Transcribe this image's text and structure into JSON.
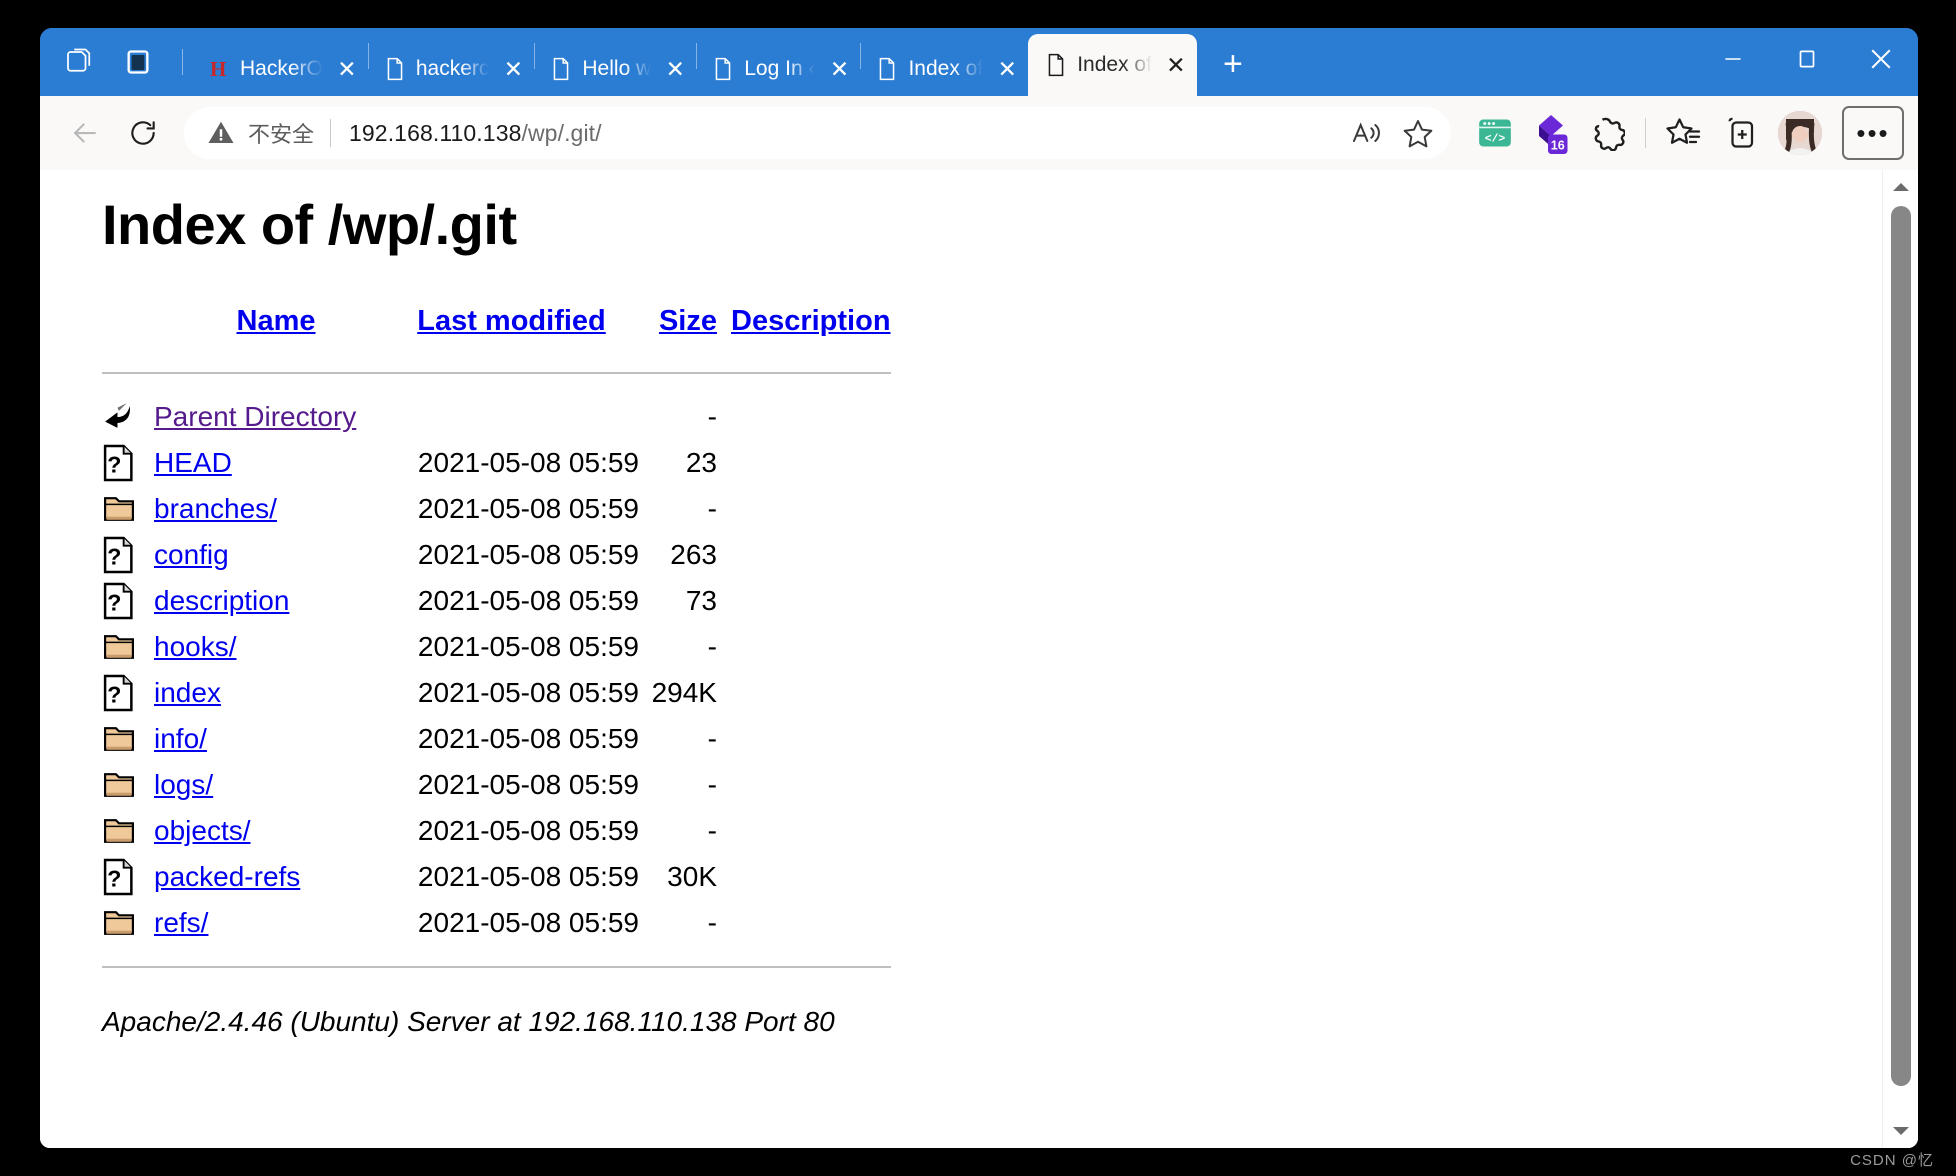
{
  "window": {
    "controls": {
      "minimize": "—",
      "maximize": "☐",
      "close": "✕"
    },
    "tab_actions": {
      "new_tab": "+",
      "close_tab": "✕"
    }
  },
  "titlebar": {
    "icons": [
      {
        "name": "workspaces-icon",
        "glyph": "⬡"
      },
      {
        "name": "tab-actions-icon",
        "glyph": "▣"
      }
    ],
    "tabs": [
      {
        "title": "HackerO",
        "favicon": "hackerone-icon",
        "active": false
      },
      {
        "title": "hackerc",
        "favicon": "page-icon",
        "active": false
      },
      {
        "title": "Hello w",
        "favicon": "page-icon",
        "active": false
      },
      {
        "title": "Log In ‹",
        "favicon": "page-icon",
        "active": false
      },
      {
        "title": "Index of",
        "favicon": "page-icon",
        "active": false
      },
      {
        "title": "Index of",
        "favicon": "page-icon",
        "active": true
      }
    ]
  },
  "toolbar": {
    "back_label": "←",
    "refresh_label": "↻",
    "security_label": "不安全",
    "url": "192.168.110.138",
    "url_path": "/wp/.git/",
    "url_full": "192.168.110.138/wp/.git/",
    "read_aloud_label": "A",
    "extensions": [
      {
        "name": "code-extension-icon",
        "badge": "",
        "color": "#3cb795"
      },
      {
        "name": "puzzle-extension-icon",
        "badge": "16",
        "color": "#6a28d7"
      },
      {
        "name": "browser-essentials-icon",
        "badge": "",
        "color": "#1f1f1f"
      }
    ],
    "collections_label": "collections-icon",
    "split_screen_label": "add-device-icon",
    "profile_label": "avatar",
    "settings_label": "•••"
  },
  "page": {
    "title": "Index of /wp/.git",
    "columns": [
      "Name",
      "Last modified",
      "Size",
      "Description"
    ],
    "rows": [
      {
        "icon": "back-arrow-icon",
        "name": "Parent Directory",
        "visited": true,
        "modified": "",
        "size": "-",
        "description": ""
      },
      {
        "icon": "unknown-file-icon",
        "name": "HEAD",
        "visited": false,
        "modified": "2021-05-08 05:59",
        "size": "23",
        "description": ""
      },
      {
        "icon": "folder-icon",
        "name": "branches/",
        "visited": false,
        "modified": "2021-05-08 05:59",
        "size": "-",
        "description": ""
      },
      {
        "icon": "unknown-file-icon",
        "name": "config",
        "visited": false,
        "modified": "2021-05-08 05:59",
        "size": "263",
        "description": ""
      },
      {
        "icon": "unknown-file-icon",
        "name": "description",
        "visited": false,
        "modified": "2021-05-08 05:59",
        "size": "73",
        "description": ""
      },
      {
        "icon": "folder-icon",
        "name": "hooks/",
        "visited": false,
        "modified": "2021-05-08 05:59",
        "size": "-",
        "description": ""
      },
      {
        "icon": "unknown-file-icon",
        "name": "index",
        "visited": false,
        "modified": "2021-05-08 05:59",
        "size": "294K",
        "description": ""
      },
      {
        "icon": "folder-icon",
        "name": "info/",
        "visited": false,
        "modified": "2021-05-08 05:59",
        "size": "-",
        "description": ""
      },
      {
        "icon": "folder-icon",
        "name": "logs/",
        "visited": false,
        "modified": "2021-05-08 05:59",
        "size": "-",
        "description": ""
      },
      {
        "icon": "folder-icon",
        "name": "objects/",
        "visited": false,
        "modified": "2021-05-08 05:59",
        "size": "-",
        "description": ""
      },
      {
        "icon": "unknown-file-icon",
        "name": "packed-refs",
        "visited": false,
        "modified": "2021-05-08 05:59",
        "size": "30K",
        "description": ""
      },
      {
        "icon": "folder-icon",
        "name": "refs/",
        "visited": false,
        "modified": "2021-05-08 05:59",
        "size": "-",
        "description": ""
      }
    ],
    "server_signature": "Apache/2.4.46 (Ubuntu) Server at 192.168.110.138 Port 80"
  },
  "scrollbar": {
    "up": "▲",
    "down": "▼"
  },
  "watermark": "CSDN @忆",
  "colors": {
    "titlebar": "#2b7cd3",
    "toolbar": "#faf9f8",
    "link": "#0000ee",
    "visited_link": "#551a8b",
    "accent_purple": "#6a28d7",
    "accent_green": "#3cb795"
  }
}
